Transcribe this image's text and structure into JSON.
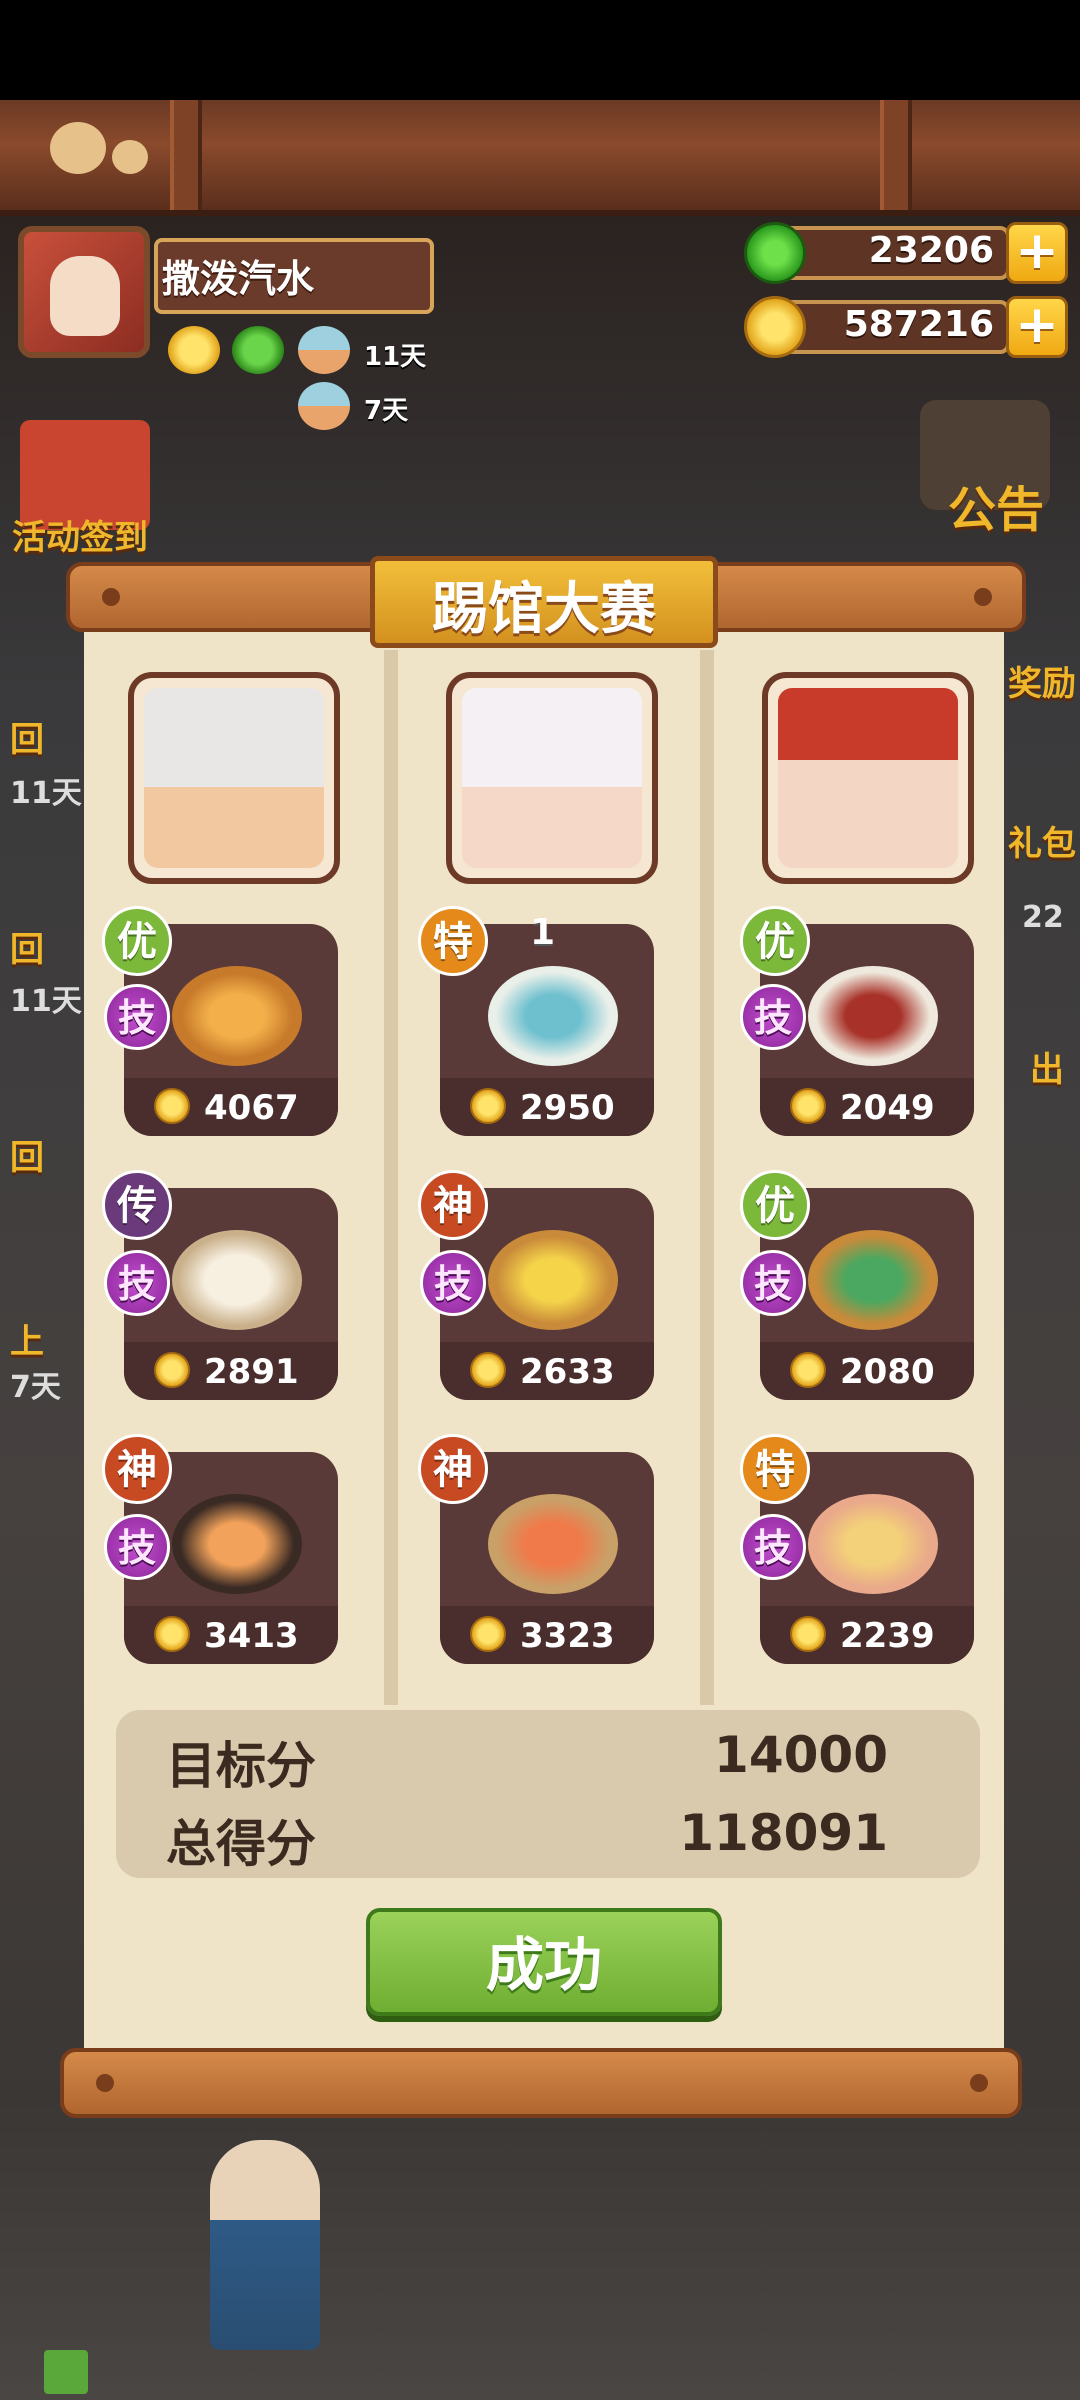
{
  "player": {
    "name": "撒泼汽水",
    "buffs": [
      {
        "icon": "gold-coin-buff-icon",
        "label": ""
      },
      {
        "icon": "jade-buff-icon",
        "label": ""
      },
      {
        "icon": "bowl-buff-icon",
        "label": "11天"
      },
      {
        "icon": "bowl-buff-icon",
        "label": "7天"
      }
    ]
  },
  "currencies": {
    "jade": "23206",
    "coins": "587216"
  },
  "side_events": {
    "checkin": "活动签到",
    "announcement": "公告",
    "left_items": [
      "回",
      "11天",
      "回",
      "11天",
      "回",
      "上",
      "7天"
    ],
    "right_items": [
      "奖励",
      "礼包",
      "22",
      "出"
    ]
  },
  "modal": {
    "title": "踢馆大赛",
    "columns": [
      {
        "portrait": "white-hair-chef-portrait",
        "dishes": [
          {
            "rank": "优",
            "rank_color": "#7cb83a",
            "skill": "技",
            "score": "4067",
            "dish": "soup-pot"
          },
          {
            "rank": "传",
            "rank_color": "#6b3a7a",
            "skill": "技",
            "score": "2891",
            "dish": "steamed-bun"
          },
          {
            "rank": "神",
            "rank_color": "#c84a22",
            "skill": "技",
            "score": "3413",
            "dish": "hot-pot"
          }
        ]
      },
      {
        "portrait": "white-fox-chef-portrait",
        "dishes": [
          {
            "rank": "特",
            "rank_color": "#e58a1a",
            "skill": "",
            "score": "2950",
            "dish": "cake",
            "extra": "1"
          },
          {
            "rank": "神",
            "rank_color": "#c84a22",
            "skill": "技",
            "score": "2633",
            "dish": "fried-dish"
          },
          {
            "rank": "神",
            "rank_color": "#c84a22",
            "skill": "技",
            "score": "3323",
            "dish": "salmon-platter"
          }
        ]
      },
      {
        "portrait": "red-hat-chef-portrait",
        "dishes": [
          {
            "rank": "优",
            "rank_color": "#7cb83a",
            "skill": "技",
            "score": "2049",
            "dish": "braised-pork"
          },
          {
            "rank": "优",
            "rank_color": "#7cb83a",
            "skill": "技",
            "score": "2080",
            "dish": "bamboo-platter"
          },
          {
            "rank": "特",
            "rank_color": "#e58a1a",
            "skill": "技",
            "score": "2239",
            "dish": "custard-dish"
          }
        ]
      }
    ],
    "target_label": "目标分",
    "target_value": "14000",
    "total_label": "总得分",
    "total_value": "118091",
    "result_button": "成功"
  }
}
